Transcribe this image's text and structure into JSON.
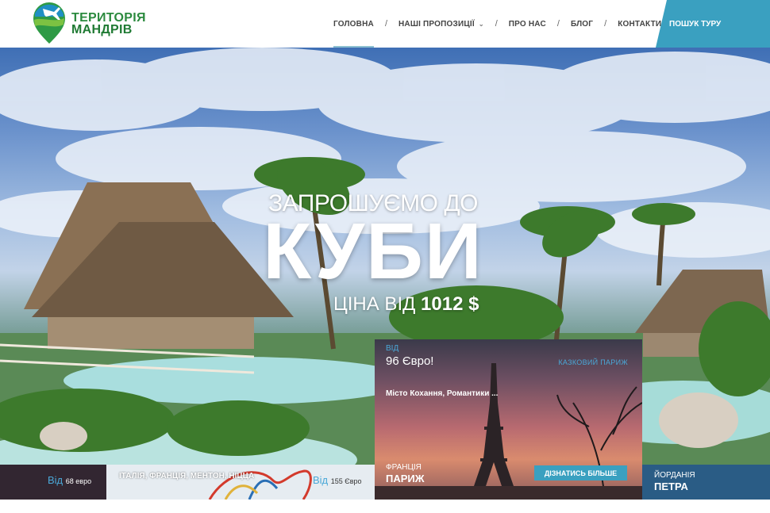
{
  "brand": {
    "line1": "ТЕРИТОРІЯ",
    "line2": "МАНДРІВ"
  },
  "nav": {
    "items": [
      "ГОЛОВНА",
      "НАШІ ПРОПОЗИЦІЇ",
      "ПРО НАС",
      "БЛОГ",
      "КОНТАКТИ"
    ],
    "separator": "/",
    "search_label": "ПОШУК ТУРУ"
  },
  "hero": {
    "subtitle": "ЗАПРОШУЄМО ДО",
    "title": "КУБИ",
    "price_prefix": "ЦІНА ВІД",
    "price_value": "1012 $"
  },
  "tours": {
    "left": {
      "from": "Від",
      "price": "68 евро"
    },
    "middle": {
      "title": "ІТАЛІЯ, ФРАНЦІЯ, МЕНТОН, НІЦЦА",
      "from": "Від",
      "price": "155 Євро"
    },
    "featured": {
      "from": "ВІД",
      "price": "96 Євро!",
      "tag": "КАЗКОВИЙ ПАРИЖ",
      "description": "Місто Кохання, Романтики ...",
      "country": "ФРАНЦІЯ",
      "city": "ПАРИЖ",
      "button": "ДІЗНАТИСЬ БІЛЬШЕ"
    },
    "right": {
      "country": "ЙОРДАНІЯ",
      "city": "ПЕТРА"
    }
  },
  "colors": {
    "accent": "#3aa0c0",
    "brand_green": "#2b8a3e",
    "nav_text": "#444444"
  }
}
